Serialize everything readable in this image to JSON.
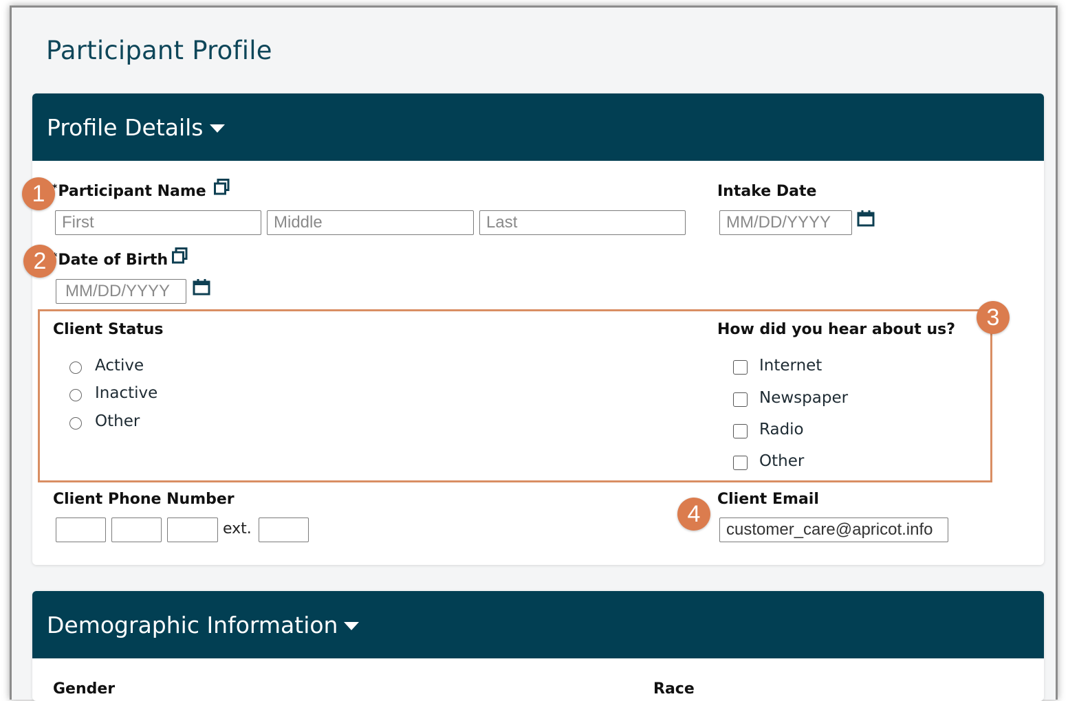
{
  "page_title": "Participant Profile",
  "profile_details": {
    "header": "Profile Details",
    "participant_name": {
      "label": "Participant Name",
      "required_mark": "*",
      "first_placeholder": "First",
      "middle_placeholder": "Middle",
      "last_placeholder": "Last"
    },
    "intake_date": {
      "label": "Intake Date",
      "placeholder": "MM/DD/YYYY"
    },
    "date_of_birth": {
      "label": "Date of Birth",
      "required_mark": "*",
      "placeholder": "MM/DD/YYYY"
    },
    "client_status": {
      "label": "Client Status",
      "options": [
        "Active",
        "Inactive",
        "Other"
      ]
    },
    "how_heard": {
      "label": "How did you hear about us?",
      "options": [
        "Internet",
        "Newspaper",
        "Radio",
        "Other"
      ]
    },
    "client_phone": {
      "label": "Client Phone Number",
      "ext_label": "ext."
    },
    "client_email": {
      "label": "Client Email",
      "value": "customer_care@apricot.info"
    }
  },
  "demographic_information": {
    "header": "Demographic Information",
    "gender_label": "Gender",
    "race_label": "Race"
  },
  "callouts": [
    "1",
    "2",
    "3",
    "4"
  ],
  "icons": {
    "popup": "open-in-new-window-icon",
    "calendar": "calendar-icon",
    "caret": "caret-down-icon"
  },
  "colors": {
    "header_bg": "#023f53",
    "title_text": "#0e4659",
    "callout_badge": "#db7c4e",
    "highlight_border": "#d98e63"
  }
}
